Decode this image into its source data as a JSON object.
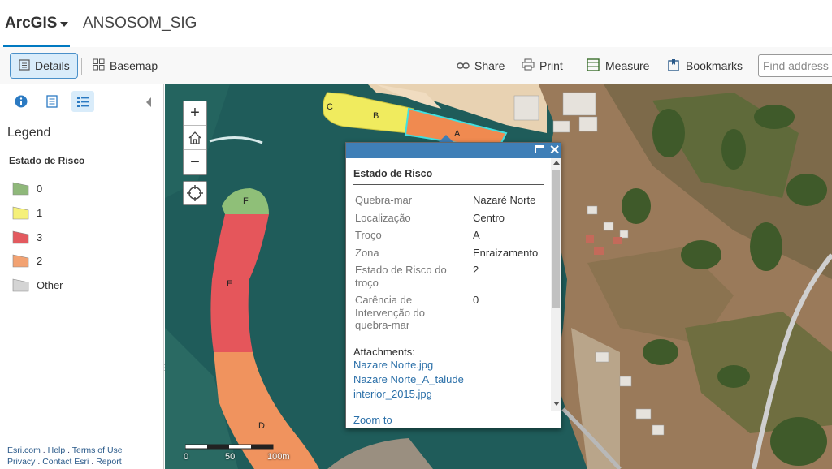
{
  "header": {
    "brand": "ArcGIS",
    "app_title": "ANSOSOM_SIG"
  },
  "toolbar": {
    "details_label": "Details",
    "basemap_label": "Basemap",
    "share_label": "Share",
    "print_label": "Print",
    "measure_label": "Measure",
    "bookmarks_label": "Bookmarks",
    "search_placeholder": "Find address o"
  },
  "sidebar": {
    "legend_title": "Legend",
    "layer_title": "Estado de Risco",
    "legend_items": [
      {
        "label": "0",
        "color": "#8fb87a"
      },
      {
        "label": "1",
        "color": "#f5f07a"
      },
      {
        "label": "3",
        "color": "#e35a5f"
      },
      {
        "label": "2",
        "color": "#f2a272"
      },
      {
        "label": "Other",
        "color": "#d4d4d4"
      }
    ],
    "footer": {
      "line1": [
        "Esri.com",
        "Help",
        "Terms of Use"
      ],
      "line2": [
        "Privacy",
        "Contact Esri",
        "Report"
      ]
    }
  },
  "map": {
    "segment_labels": [
      "A",
      "B",
      "C",
      "D",
      "E",
      "F"
    ],
    "scale_labels": [
      "0",
      "50",
      "100m"
    ]
  },
  "popup": {
    "title": "Estado de Risco",
    "attributes": [
      {
        "key": "Quebra-mar",
        "value": "Nazaré Norte"
      },
      {
        "key": "Localização",
        "value": "Centro"
      },
      {
        "key": "Troço",
        "value": "A"
      },
      {
        "key": "Zona",
        "value": "Enraizamento"
      },
      {
        "key": "Estado de Risco do troço",
        "value": "2"
      },
      {
        "key": "Carência de Intervenção do quebra-mar",
        "value": "0"
      }
    ],
    "attachments_label": "Attachments:",
    "attachments": [
      "Nazare Norte.jpg",
      "Nazare Norte_A_talude interior_2015.jpg"
    ],
    "zoom_to": "Zoom to"
  },
  "colors": {
    "accent": "#0079c1",
    "popup_header": "#3f7fb7",
    "water": "#1f5c5a"
  }
}
